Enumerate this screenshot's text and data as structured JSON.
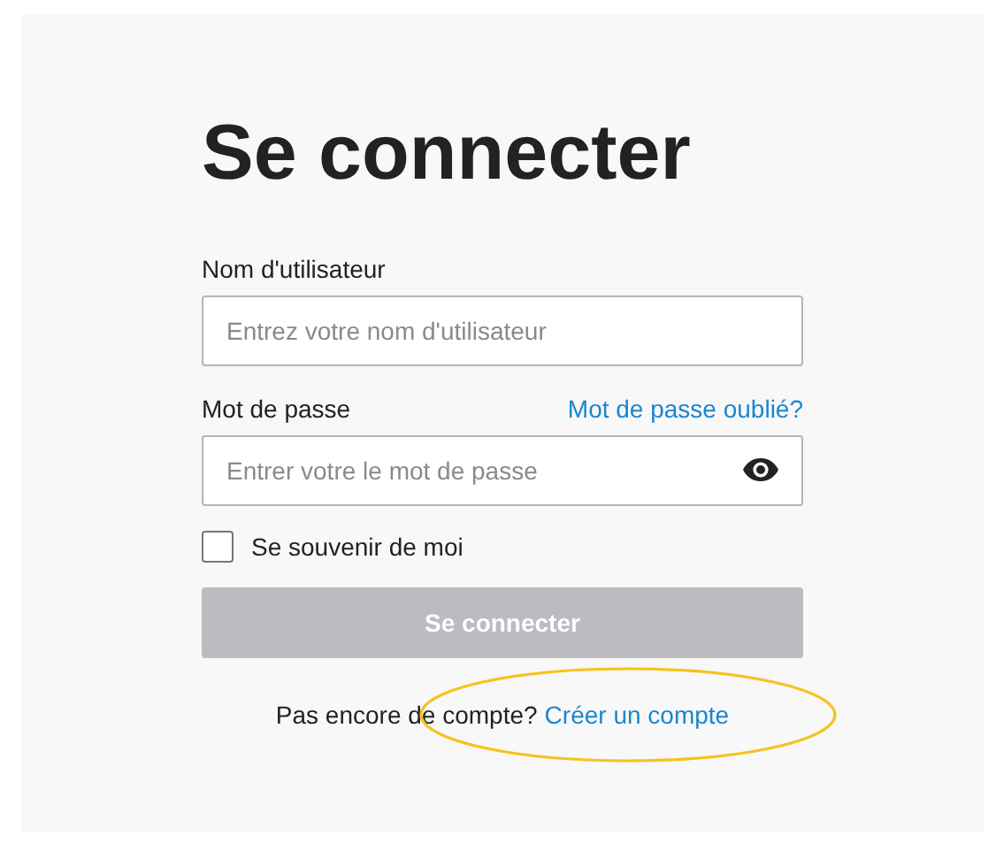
{
  "title": "Se connecter",
  "fields": [
    {
      "kind": "text",
      "label": "Nom d'utilisateur",
      "placeholder": "Entrez votre nom d'utilisateur"
    },
    {
      "kind": "password",
      "label": "Mot de passe",
      "link": "Mot de passe oublié?",
      "placeholder": "Entrer votre le mot de passe"
    }
  ],
  "remember": {
    "label": "Se souvenir de moi",
    "checked": false
  },
  "submit": {
    "label": "Se connecter",
    "disabled": true
  },
  "footer": {
    "text": "Pas encore de compte?",
    "link": "Créer un compte"
  },
  "annotation": {
    "kind": "ellipse",
    "color": "#f5c31c"
  }
}
